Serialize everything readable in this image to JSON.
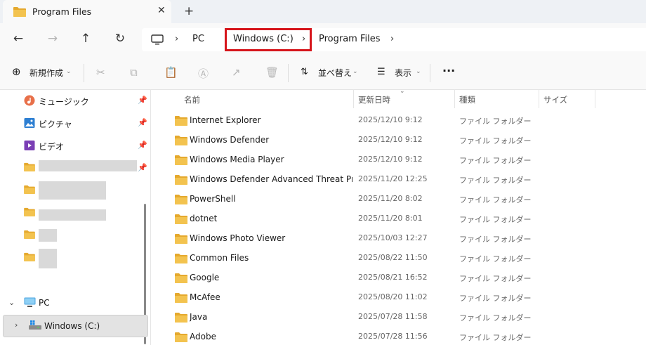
{
  "tab": {
    "title": "Program Files",
    "close_glyph": "✕",
    "new_tab_glyph": "+"
  },
  "nav_buttons": {
    "back": "←",
    "forward": "→",
    "up": "↑",
    "refresh": "↻"
  },
  "breadcrumb": {
    "items": [
      "PC",
      "Windows (C:)",
      "Program Files"
    ],
    "separator": "›",
    "highlighted_item": "Windows (C:)",
    "highlight_color": "#d6151b"
  },
  "commands": {
    "new": "新規作成",
    "sort": "並べ替え",
    "view": "表示",
    "more": "···",
    "icons": [
      "cut-icon",
      "copy-icon",
      "paste-icon",
      "rename-icon",
      "share-icon",
      "delete-icon"
    ]
  },
  "sidebar": {
    "quick_access": [
      {
        "label": "ミュージック",
        "icon": "music-icon",
        "pinned": true
      },
      {
        "label": "ピクチャ",
        "icon": "pictures-icon",
        "pinned": true
      },
      {
        "label": "ビデオ",
        "icon": "videos-icon",
        "pinned": true
      }
    ],
    "pc_label": "PC",
    "drive_label": "Windows (C:)",
    "pin_glyph": "📌"
  },
  "columns": {
    "name": "名前",
    "modified": "更新日時",
    "type": "種類",
    "size": "サイズ"
  },
  "files": [
    {
      "name": "Internet Explorer",
      "modified": "2025/12/10 9:12",
      "type": "ファイル フォルダー"
    },
    {
      "name": "Windows Defender",
      "modified": "2025/12/10 9:12",
      "type": "ファイル フォルダー"
    },
    {
      "name": "Windows Media Player",
      "modified": "2025/12/10 9:12",
      "type": "ファイル フォルダー"
    },
    {
      "name": "Windows Defender Advanced Threat Prot...",
      "modified": "2025/11/20 12:25",
      "type": "ファイル フォルダー"
    },
    {
      "name": "PowerShell",
      "modified": "2025/11/20 8:02",
      "type": "ファイル フォルダー"
    },
    {
      "name": "dotnet",
      "modified": "2025/11/20 8:01",
      "type": "ファイル フォルダー"
    },
    {
      "name": "Windows Photo Viewer",
      "modified": "2025/10/03 12:27",
      "type": "ファイル フォルダー"
    },
    {
      "name": "Common Files",
      "modified": "2025/08/22 11:50",
      "type": "ファイル フォルダー"
    },
    {
      "name": "Google",
      "modified": "2025/08/21 16:52",
      "type": "ファイル フォルダー"
    },
    {
      "name": "McAfee",
      "modified": "2025/08/20 11:02",
      "type": "ファイル フォルダー"
    },
    {
      "name": "Java",
      "modified": "2025/07/28 11:58",
      "type": "ファイル フォルダー"
    },
    {
      "name": "Adobe",
      "modified": "2025/07/28 11:56",
      "type": "ファイル フォルダー"
    }
  ],
  "colors": {
    "folder": "#f3c34f",
    "folder_dark": "#e5a92e",
    "accent": "#0067c0"
  }
}
